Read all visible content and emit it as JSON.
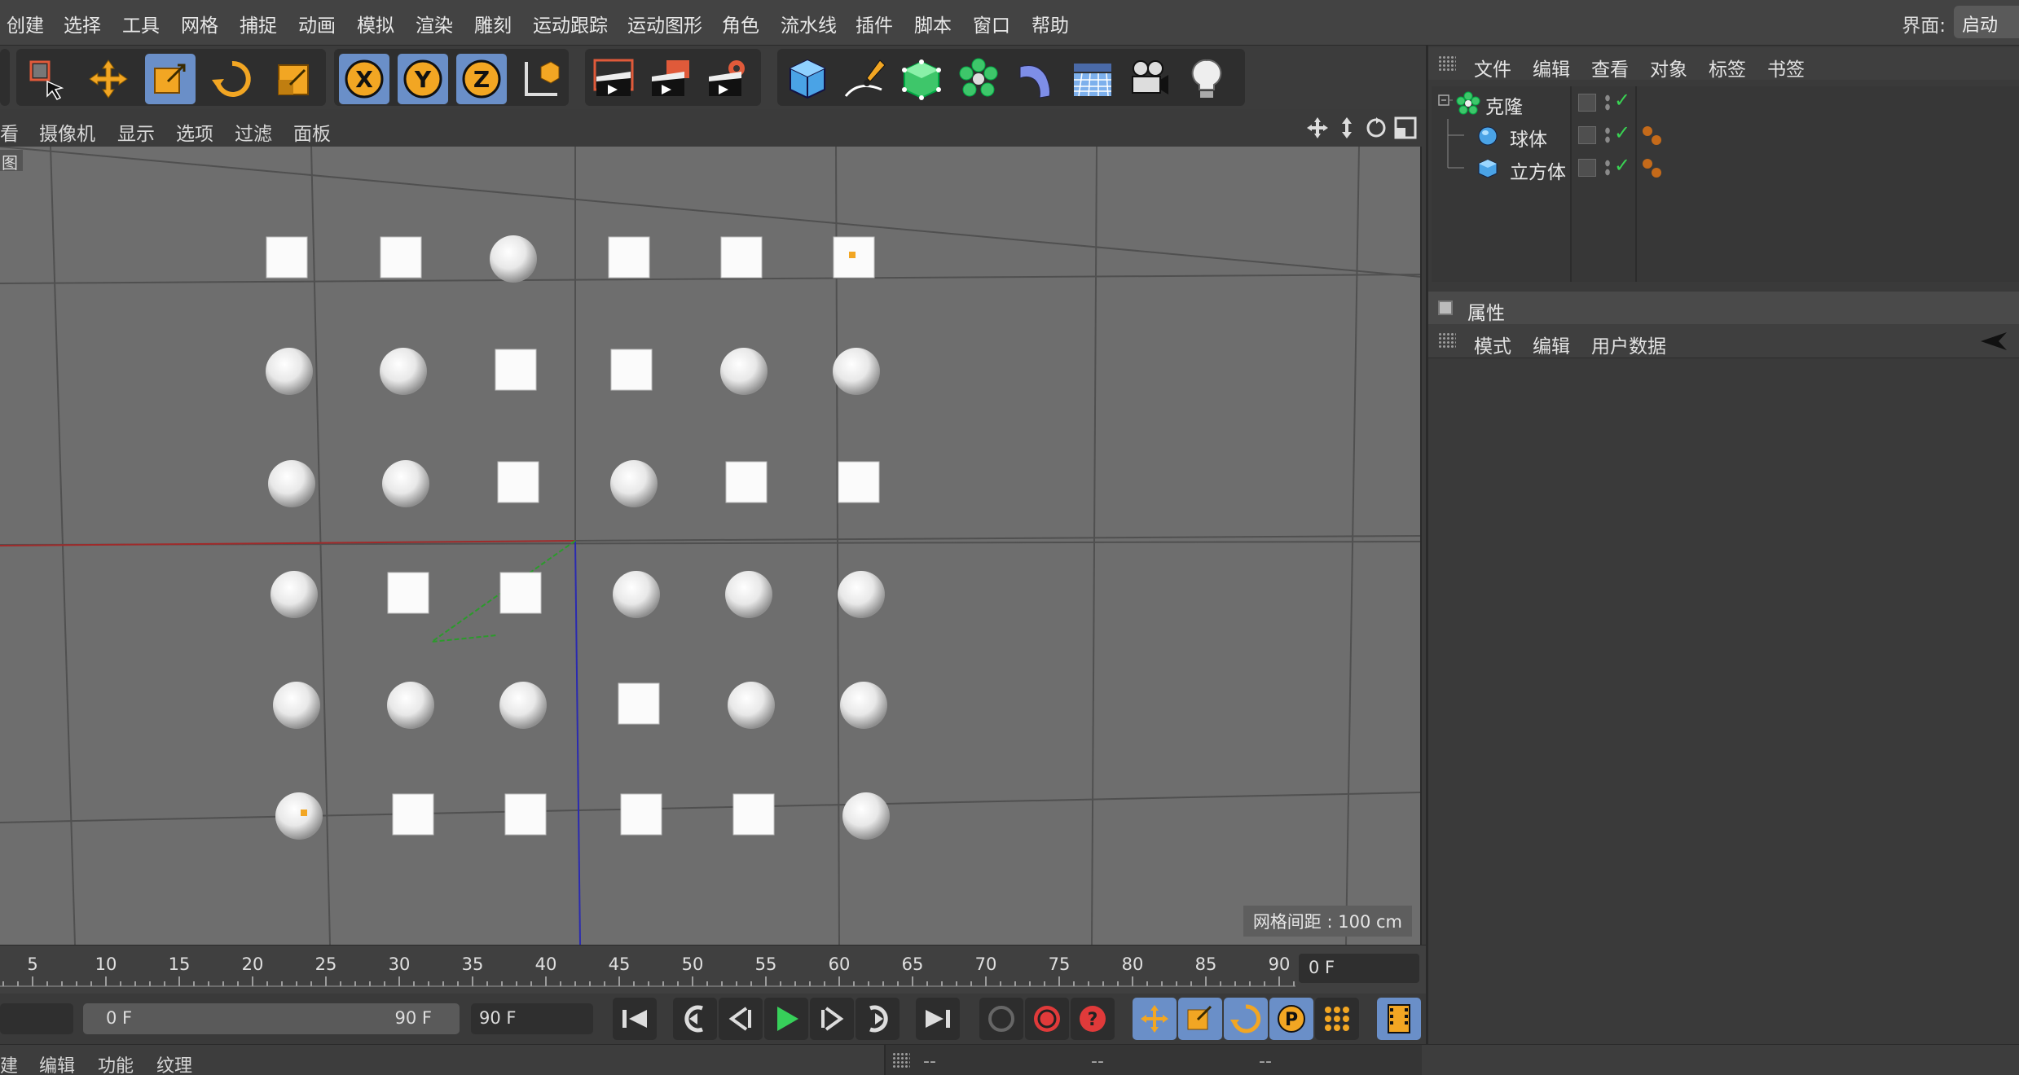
{
  "menubar": {
    "items": [
      "创建",
      "选择",
      "工具",
      "网格",
      "捕捉",
      "动画",
      "模拟",
      "渲染",
      "雕刻",
      "运动跟踪",
      "运动图形",
      "角色",
      "流水线",
      "插件",
      "脚本",
      "窗口",
      "帮助"
    ],
    "ui_label": "界面:",
    "ui_value": "启动"
  },
  "toolbar": {
    "buttons": [
      {
        "name": "live-selection-icon",
        "active": false
      },
      {
        "name": "move-icon",
        "active": false
      },
      {
        "name": "scale-icon",
        "active": true
      },
      {
        "name": "rotate-icon",
        "active": false
      },
      {
        "name": "recent-tool-icon",
        "active": false
      },
      {
        "name": "x-axis-lock-icon",
        "active": true,
        "label": "X"
      },
      {
        "name": "y-axis-lock-icon",
        "active": true,
        "label": "Y"
      },
      {
        "name": "z-axis-lock-icon",
        "active": true,
        "label": "Z"
      },
      {
        "name": "coordinate-system-icon",
        "active": false
      },
      {
        "name": "render-view-icon",
        "active": false
      },
      {
        "name": "render-picture-viewer-icon",
        "active": false
      },
      {
        "name": "render-settings-icon",
        "active": false
      },
      {
        "name": "cube-object-icon",
        "active": false
      },
      {
        "name": "pen-spline-icon",
        "active": false
      },
      {
        "name": "subdivision-surface-icon",
        "active": false
      },
      {
        "name": "cloner-icon",
        "active": false
      },
      {
        "name": "bend-deformer-icon",
        "active": false
      },
      {
        "name": "floor-icon",
        "active": false
      },
      {
        "name": "camera-icon",
        "active": false
      },
      {
        "name": "light-icon",
        "active": false
      }
    ],
    "accent": "#6a8fc8"
  },
  "viewport": {
    "menu": [
      "看",
      "摄像机",
      "显示",
      "选项",
      "过滤",
      "面板"
    ],
    "tag": "图",
    "grid_spacing_label": "网格间距 : 100 cm",
    "clone_grid_rows": [
      [
        "cube",
        "cube",
        "sphere",
        "cube",
        "cube",
        "cube"
      ],
      [
        "sphere",
        "sphere",
        "cube",
        "cube",
        "sphere",
        "sphere"
      ],
      [
        "sphere",
        "sphere",
        "cube",
        "sphere",
        "cube",
        "cube"
      ],
      [
        "sphere",
        "cube",
        "cube",
        "sphere",
        "sphere",
        "sphere"
      ],
      [
        "sphere",
        "sphere",
        "sphere",
        "cube",
        "sphere",
        "sphere"
      ],
      [
        "sphere",
        "cube",
        "cube",
        "cube",
        "cube",
        "sphere"
      ]
    ]
  },
  "timeline": {
    "ticks": [
      "5",
      "10",
      "15",
      "20",
      "25",
      "30",
      "35",
      "40",
      "45",
      "50",
      "55",
      "60",
      "65",
      "70",
      "75",
      "80",
      "85",
      "90"
    ],
    "current_frame": "0 F"
  },
  "transport": {
    "range_start": "0 F",
    "range_end": "90 F",
    "end_frame": "90 F"
  },
  "bottom": {
    "menu": [
      "建",
      "编辑",
      "功能",
      "纹理"
    ],
    "coord_placeholders": [
      "--",
      "--",
      "--"
    ]
  },
  "object_manager": {
    "menu": [
      "文件",
      "编辑",
      "查看",
      "对象",
      "标签",
      "书签"
    ],
    "objects": [
      {
        "name": "克隆",
        "icon": "cloner-icon",
        "level": 0
      },
      {
        "name": "球体",
        "icon": "sphere-icon",
        "level": 1
      },
      {
        "name": "立方体",
        "icon": "cube-icon",
        "level": 1
      }
    ]
  },
  "attributes": {
    "title": "属性",
    "menu": [
      "模式",
      "编辑",
      "用户数据"
    ]
  }
}
